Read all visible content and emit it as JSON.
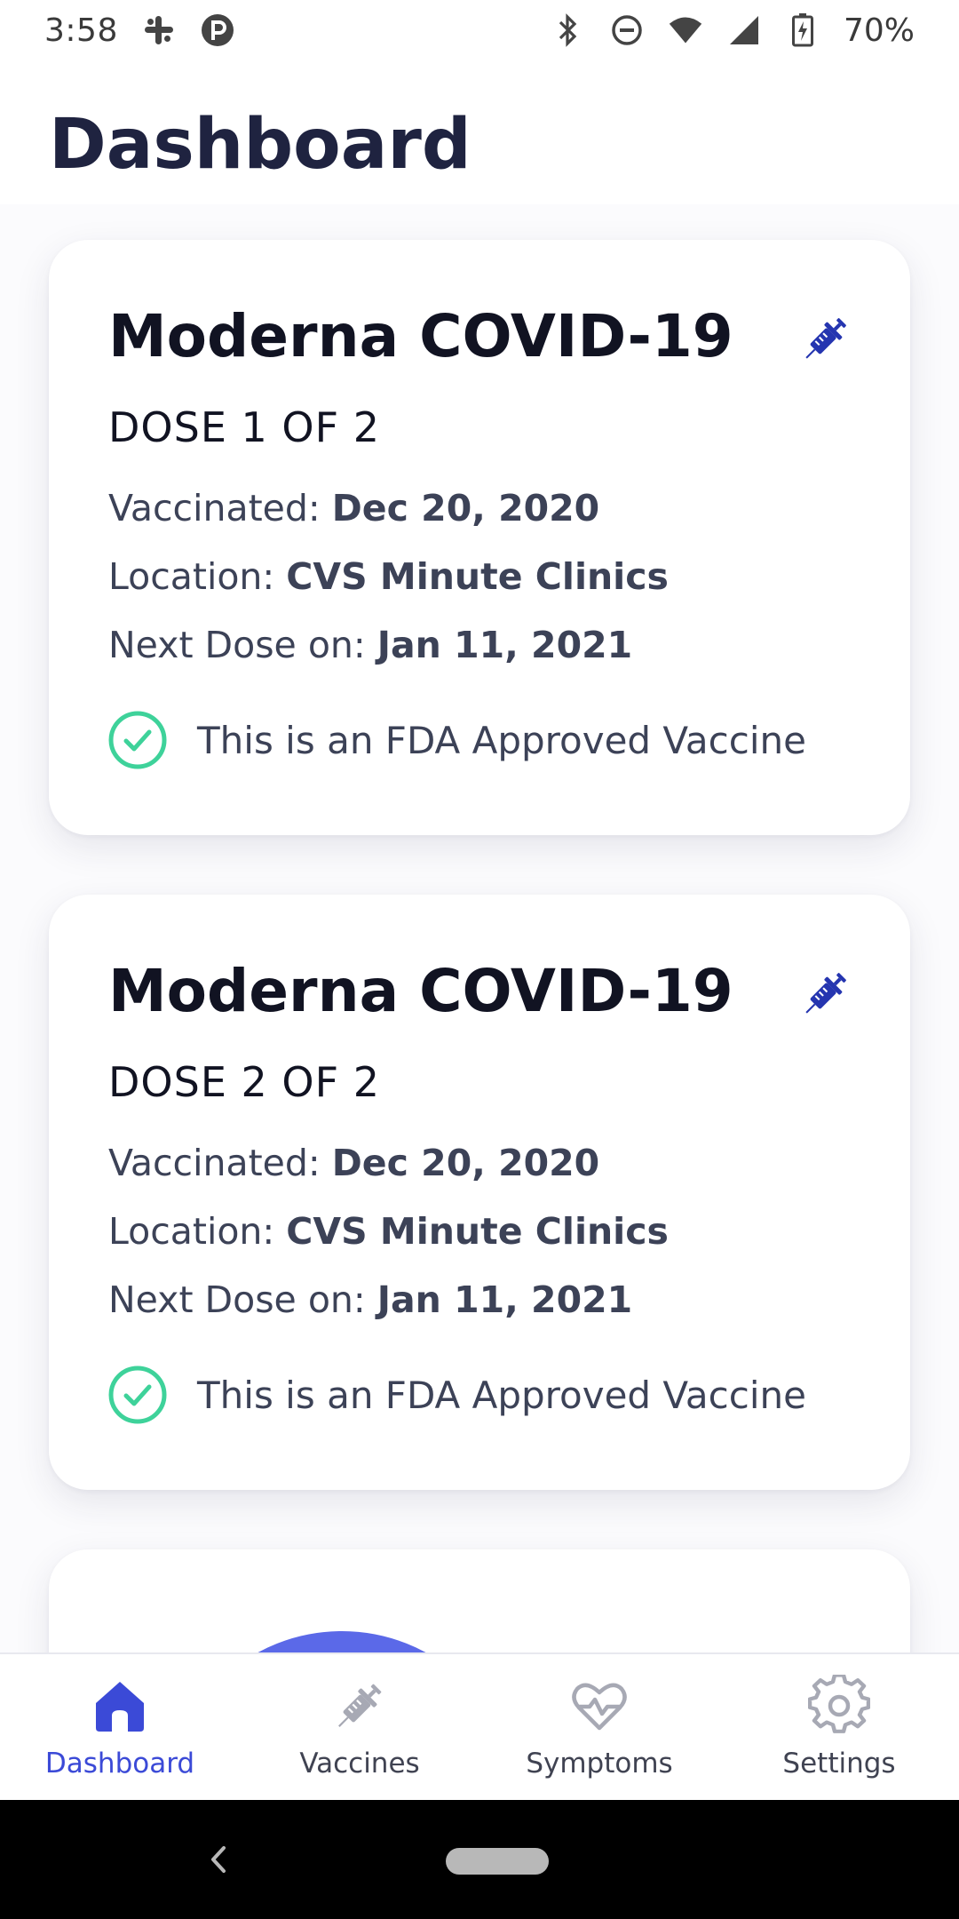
{
  "status_bar": {
    "time": "3:58",
    "battery": "70%",
    "icons": [
      "slack-icon",
      "app-icon",
      "bluetooth-icon",
      "dnd-icon",
      "wifi-icon",
      "signal-icon",
      "battery-icon"
    ]
  },
  "header": {
    "title": "Dashboard"
  },
  "cards": [
    {
      "title": "Moderna COVID-19",
      "dose": "DOSE 1 OF 2",
      "vaccinated_label": "Vaccinated: ",
      "vaccinated_value": "Dec 20, 2020",
      "location_label": "Location: ",
      "location_value": "CVS Minute Clinics",
      "next_label": "Next Dose on: ",
      "next_value": "Jan 11, 2021",
      "approved_text": "This is an FDA Approved Vaccine"
    },
    {
      "title": "Moderna COVID-19",
      "dose": "DOSE 2 OF 2",
      "vaccinated_label": "Vaccinated: ",
      "vaccinated_value": "Dec 20, 2020",
      "location_label": "Location: ",
      "location_value": "CVS Minute Clinics",
      "next_label": "Next Dose on: ",
      "next_value": "Jan 11, 2021",
      "approved_text": "This is an FDA Approved Vaccine"
    }
  ],
  "bottom_nav": {
    "items": [
      {
        "label": "Dashboard",
        "icon": "home-icon",
        "active": true
      },
      {
        "label": "Vaccines",
        "icon": "syringe-icon",
        "active": false
      },
      {
        "label": "Symptoms",
        "icon": "heart-pulse-icon",
        "active": false
      },
      {
        "label": "Settings",
        "icon": "gear-icon",
        "active": false
      }
    ]
  },
  "colors": {
    "accent": "#3b4ad7",
    "syringe": "#2535b0",
    "check": "#3ed29a",
    "title": "#1f2340",
    "text": "#3c4257",
    "arc": "#5b69e8"
  }
}
